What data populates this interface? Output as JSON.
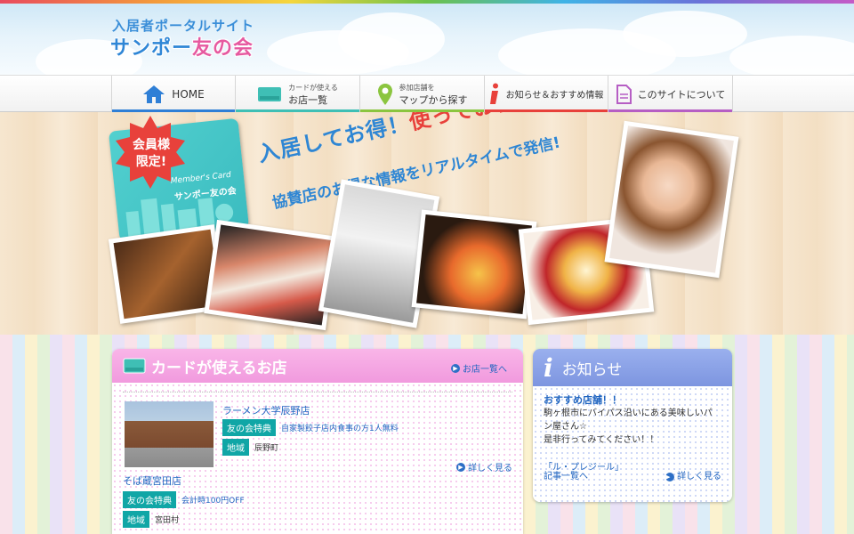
{
  "header": {
    "subtitle": "入居者ポータルサイト",
    "logo_main": "サンポー",
    "logo_accent": "友の会"
  },
  "nav": {
    "items": [
      {
        "label": "HOME",
        "icon": "home-icon",
        "color": "#2f7fd6"
      },
      {
        "small": "カードが使える",
        "big": "お店一覧",
        "icon": "card-icon",
        "color": "#3fbfb5"
      },
      {
        "small": "参加店舗を",
        "big": "マップから探す",
        "icon": "map-pin-icon",
        "color": "#8bc53f"
      },
      {
        "label": "お知らせ＆おすすめ情報",
        "icon": "info-icon",
        "color": "#e8413b"
      },
      {
        "label": "このサイトについて",
        "icon": "document-icon",
        "color": "#b65ec4"
      }
    ]
  },
  "hero": {
    "line1_a": "入居してお得！",
    "line1_b": "使ってお得！",
    "line2": "協賛店のお得な情報をリアルタイムで発信!",
    "card_text1": "Member's Card",
    "card_text2": "サンポー友の会",
    "burst_line1": "会員様",
    "burst_line2": "限定!"
  },
  "shops": {
    "title": "カードが使えるお店",
    "more_link": "お店一覧へ",
    "detail_link": "詳しく見る",
    "items": [
      {
        "name": "ラーメン大学辰野店",
        "benefit_label": "友の会特典",
        "benefit": "自家製餃子店内食事の方1人無料",
        "area_label": "地域",
        "area": "辰野町"
      },
      {
        "name": "そば蔵宮田店",
        "benefit_label": "友の会特典",
        "benefit": "会計時100円OFF",
        "area_label": "地域",
        "area": "宮田村"
      }
    ]
  },
  "news": {
    "title": "お知らせ",
    "headline": "おすすめ店舗！！",
    "text": "駒ヶ根市にバイパス沿いにある美味しいパン屋さん☆",
    "text2": "是非行ってみてください！！",
    "link": "「ル・プレジール」",
    "list_link": "記事一覧へ",
    "detail_link": "詳しく見る"
  }
}
